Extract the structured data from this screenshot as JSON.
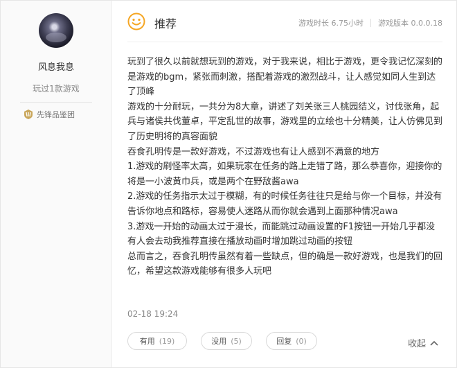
{
  "user": {
    "name": "风息我息",
    "played": "玩过1款游戏",
    "badge": "先锋品鉴团"
  },
  "review": {
    "verdict": "推荐",
    "playtime": "游戏时长 6.75小时",
    "version": "游戏版本 0.0.0.18",
    "paragraphs": [
      "玩到了很久以前就想玩到的游戏，对于我来说，相比于游戏，更令我记忆深刻的是游戏的bgm，紧张而刺激，搭配着游戏的激烈战斗，让人感觉如同人生到达了顶峰",
      "游戏的十分耐玩，一共分为8大章，讲述了刘关张三人桃园结义，讨伐张角，起兵与诸侯共伐董卓，平定乱世的故事，游戏里的立绘也十分精美，让人仿佛见到了历史明将的真容面貌",
      "吞食孔明传是一款好游戏，不过游戏也有让人感到不满意的地方",
      "1.游戏的刷怪率太高，如果玩家在任务的路上走错了路，那么恭喜你，迎接你的将是一小波黄巾兵，或是两个在野敌酱awa",
      "2.游戏的任务指示太过于模糊，有的时候任务往往只是给与你一个目标，并没有告诉你地点和路标，容易使人迷路从而你就会遇到上面那种情况awa",
      "3.游戏一开始的动画太过于漫长，而能跳过动画设置的F1按钮一开始几乎都没有人会去动我推荐直接在播放动画时增加跳过动画的按钮",
      "总而言之，吞食孔明传虽然有着一些缺点，但的确是一款好游戏，也是我们的回忆，希望这款游戏能够有很多人玩吧"
    ],
    "date": "02-18 19:24"
  },
  "actions": {
    "useful_label": "有用",
    "useful_count": "(19)",
    "useless_label": "没用",
    "useless_count": "(5)",
    "reply_label": "回复",
    "reply_count": "(0)",
    "collapse_label": "收起"
  },
  "icons": {
    "verdict": "smile-icon",
    "badge": "pioneer-badge-icon",
    "collapse": "chevron-up-icon"
  },
  "colors": {
    "accent": "#f5a623",
    "text": "#333333",
    "muted": "#999999"
  }
}
